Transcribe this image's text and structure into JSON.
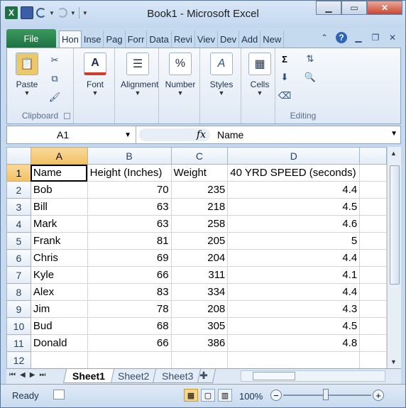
{
  "window": {
    "title": "Book1 - Microsoft Excel"
  },
  "qat": {
    "logo": "X"
  },
  "ribbon_tabs": {
    "file": "File",
    "tabs": [
      "Hon",
      "Inse",
      "Pag",
      "Forr",
      "Data",
      "Revi",
      "Viev",
      "Dev",
      "Add",
      "New"
    ]
  },
  "ribbon": {
    "clipboard": {
      "paste": "Paste",
      "label": "Clipboard"
    },
    "font": {
      "label": "Font",
      "icon_text": "A"
    },
    "alignment": {
      "label": "Alignment"
    },
    "number": {
      "label": "Number",
      "icon_text": "%"
    },
    "styles": {
      "label": "Styles"
    },
    "cells": {
      "label": "Cells"
    },
    "editing": {
      "label": "Editing",
      "sum": "Σ"
    }
  },
  "formula_bar": {
    "name_box": "A1",
    "fx": "fx",
    "value": "Name"
  },
  "sheet": {
    "columns": [
      "A",
      "B",
      "C",
      "D"
    ],
    "rows": [
      {
        "n": "1",
        "a": "Name",
        "b": "Height (Inches)",
        "c": "Weight",
        "d": "40 YRD SPEED (seconds)"
      },
      {
        "n": "2",
        "a": "Bob",
        "b": "70",
        "c": "235",
        "d": "4.4"
      },
      {
        "n": "3",
        "a": "Bill",
        "b": "63",
        "c": "218",
        "d": "4.5"
      },
      {
        "n": "4",
        "a": "Mark",
        "b": "63",
        "c": "258",
        "d": "4.6"
      },
      {
        "n": "5",
        "a": "Frank",
        "b": "81",
        "c": "205",
        "d": "5"
      },
      {
        "n": "6",
        "a": "Chris",
        "b": "69",
        "c": "204",
        "d": "4.4"
      },
      {
        "n": "7",
        "a": "Kyle",
        "b": "66",
        "c": "311",
        "d": "4.1"
      },
      {
        "n": "8",
        "a": "Alex",
        "b": "83",
        "c": "334",
        "d": "4.4"
      },
      {
        "n": "9",
        "a": "Jim",
        "b": "78",
        "c": "208",
        "d": "4.3"
      },
      {
        "n": "10",
        "a": "Bud",
        "b": "68",
        "c": "305",
        "d": "4.5"
      },
      {
        "n": "11",
        "a": "Donald",
        "b": "66",
        "c": "386",
        "d": "4.8"
      },
      {
        "n": "12",
        "a": "",
        "b": "",
        "c": "",
        "d": ""
      }
    ]
  },
  "sheet_tabs": [
    "Sheet1",
    "Sheet2",
    "Sheet3"
  ],
  "status": {
    "ready": "Ready",
    "zoom": "100%",
    "minus": "−",
    "plus": "+"
  }
}
